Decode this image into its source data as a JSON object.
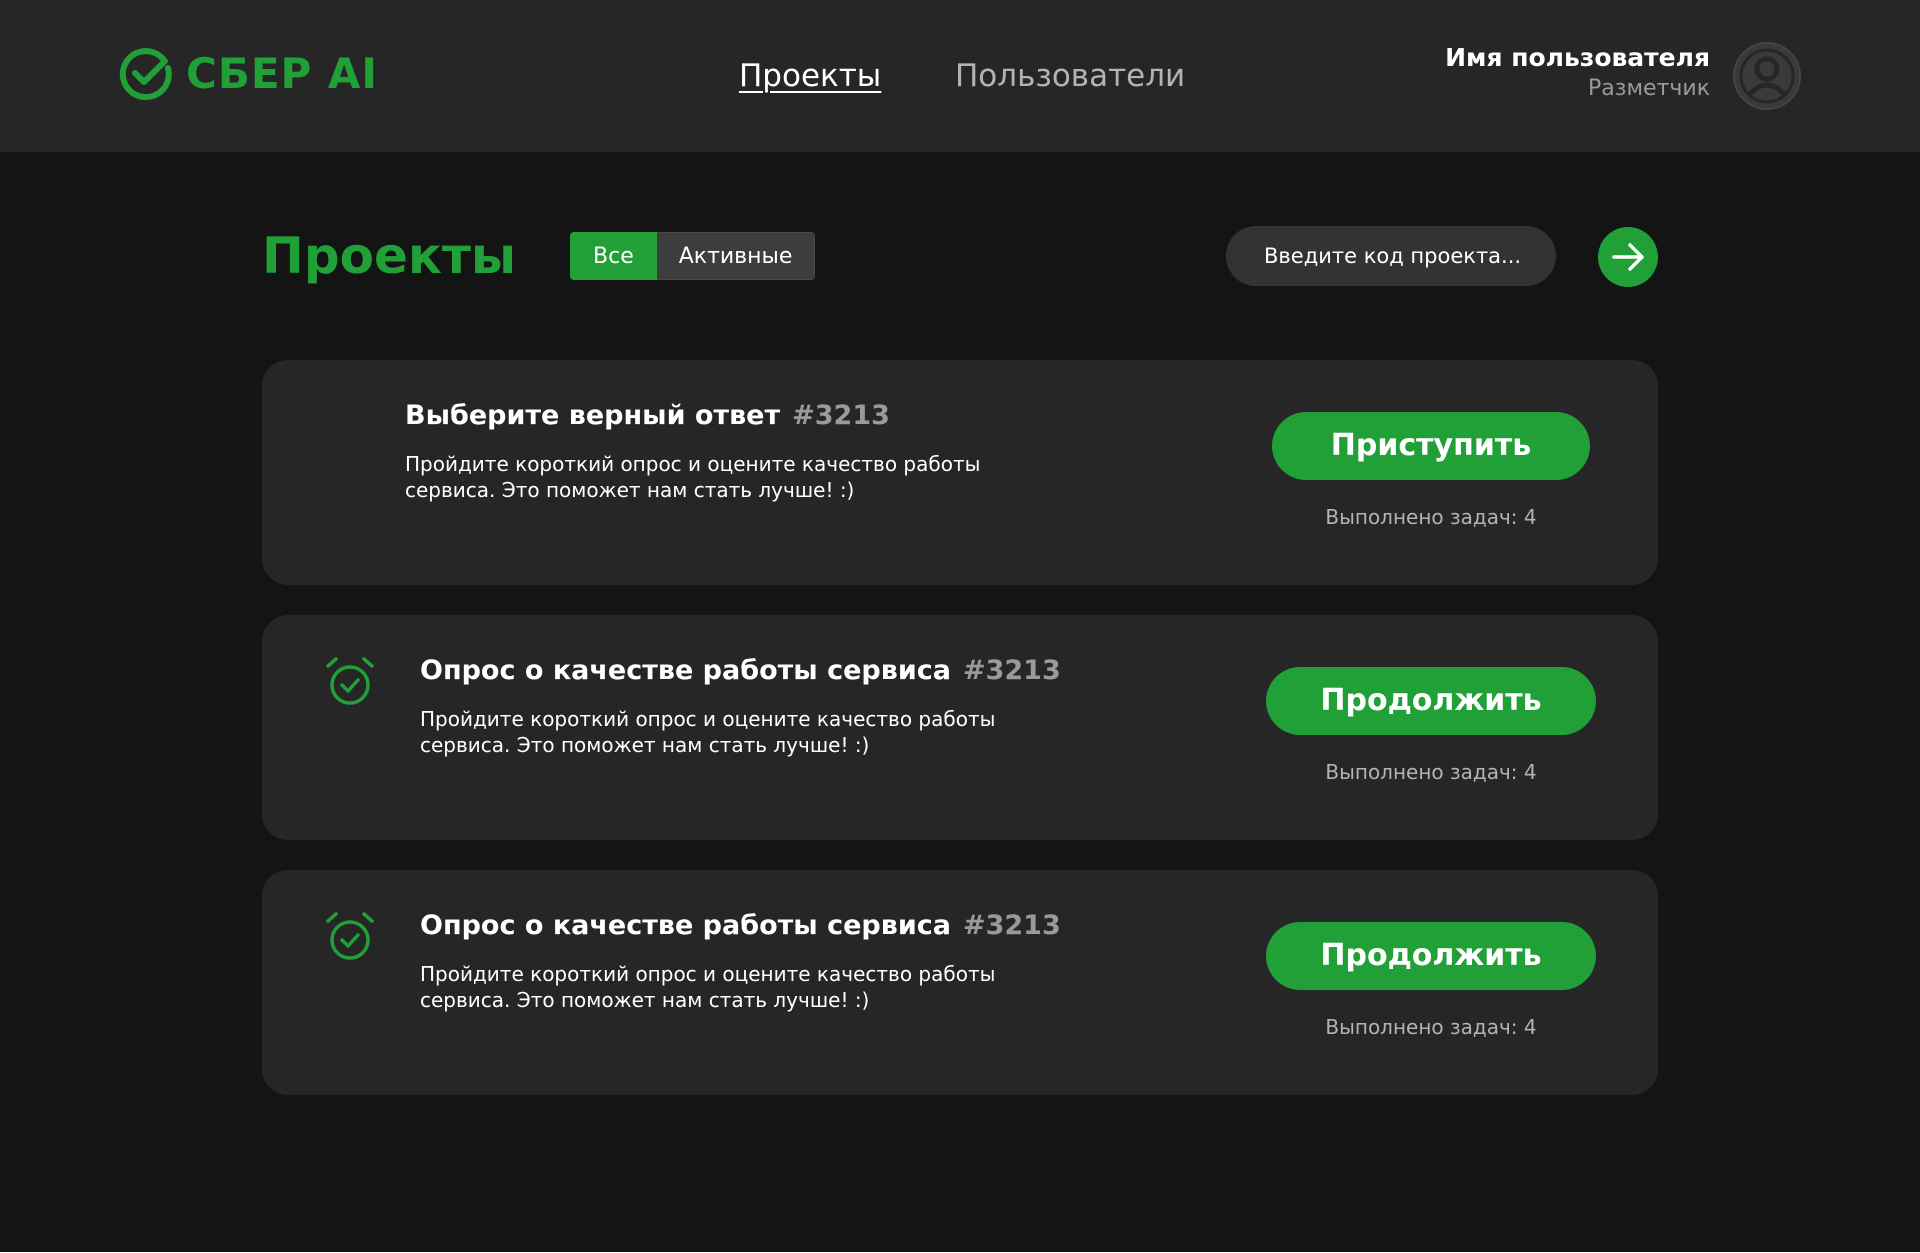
{
  "app": {
    "brand": "СБЕР AI",
    "accent_color": "#21a038",
    "background_color": "#141414",
    "surface_color": "#262626"
  },
  "nav": {
    "items": [
      {
        "label": "Проекты",
        "active": true
      },
      {
        "label": "Пользователи",
        "active": false
      }
    ]
  },
  "user": {
    "name": "Имя пользователя",
    "role": "Разметчик",
    "avatar_icon": "user-avatar-icon"
  },
  "main": {
    "title": "Проекты",
    "filters": [
      {
        "label": "Все",
        "active": true
      },
      {
        "label": "Активные",
        "active": false
      }
    ],
    "search": {
      "placeholder": "Введите код проекта..."
    },
    "go_icon": "arrow-right-icon"
  },
  "projects": [
    {
      "title": "Выберите верный ответ",
      "code": "#3213",
      "description": "Пройдите короткий опрос и оцените качество работы сервиса. Это поможет нам стать лучше! :)",
      "action_label": "Приступить",
      "progress": "Выполнено задач: 4",
      "icon": null
    },
    {
      "title": "Опрос о качестве работы сервиса",
      "code": "#3213",
      "description": "Пройдите короткий опрос и оцените качество работы сервиса. Это поможет нам стать лучше! :)",
      "action_label": "Продолжить",
      "progress": "Выполнено задач: 4",
      "icon": "alarm-check-icon"
    },
    {
      "title": "Опрос о качестве работы сервиса",
      "code": "#3213",
      "description": "Пройдите короткий опрос и оцените качество работы сервиса. Это поможет нам стать лучше! :)",
      "action_label": "Продолжить",
      "progress": "Выполнено задач: 4",
      "icon": "alarm-check-icon"
    }
  ]
}
